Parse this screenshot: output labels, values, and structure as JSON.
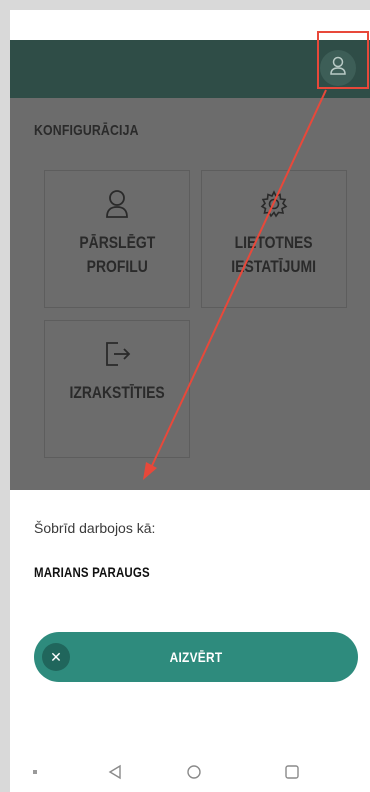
{
  "colors": {
    "app_bar": "#2f4d47",
    "overlay": "#6c6c6c",
    "accent": "#2e8b7d",
    "annotation": "#e8483a"
  },
  "header": {
    "profile_icon": "user-icon"
  },
  "config": {
    "title": "KONFIGURĀCIJA",
    "tiles": [
      {
        "label": "PĀRSLĒGT\nPROFILU",
        "icon": "user-icon"
      },
      {
        "label": "LIETOTNES\nIESTATĪJUMI",
        "icon": "gear-icon"
      },
      {
        "label": "IZRAKSTĪTIES",
        "icon": "logout-icon"
      }
    ]
  },
  "sheet": {
    "caption": "Šobrīd darbojos kā:",
    "user_name": "MARIANS PARAUGS",
    "close_label": "AIZVĒRT",
    "close_icon": "close-icon"
  },
  "nav": {
    "items": [
      "recents-dot-icon",
      "back-icon",
      "home-icon",
      "overview-icon"
    ]
  }
}
